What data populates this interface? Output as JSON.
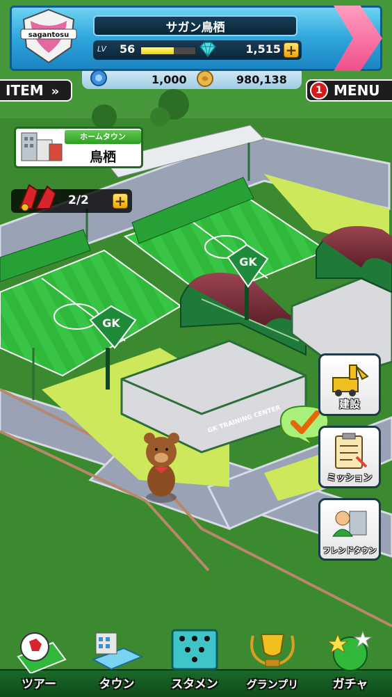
{
  "header": {
    "team_name": "サガン鳥栖",
    "logo_text": "sagantosu",
    "level_label": "LV",
    "level": "56",
    "xp_fraction": 0.6,
    "gems": "1,515",
    "plus": "+",
    "tickets": "1,000",
    "coins": "980,138"
  },
  "left_buttons": {
    "item_label": "ITEM"
  },
  "right_buttons": {
    "menu_label": "MENU",
    "menu_badge": "1"
  },
  "hometown": {
    "title": "ホームタウン",
    "name": "鳥栖"
  },
  "stock": {
    "value": "2/2"
  },
  "scene": {
    "sign_text": "GK",
    "sign_sub": "TRAINING\nCENTER",
    "roof_text": "GK TRAINING CENTER"
  },
  "side_menu": [
    {
      "label": "建設",
      "icon": "construction-icon"
    },
    {
      "label": "ミッション",
      "icon": "mission-clipboard-icon"
    },
    {
      "label": "フレンドタウン",
      "icon": "friend-town-icon"
    }
  ],
  "bottom_nav": [
    {
      "label": "ツアー",
      "icon": "soccer-ball-icon"
    },
    {
      "label": "タウン",
      "icon": "town-icon"
    },
    {
      "label": "スタメン",
      "icon": "lineup-icon"
    },
    {
      "label": "グランプリ",
      "icon": "trophy-icon"
    },
    {
      "label": "ガチャ",
      "icon": "gacha-icon"
    }
  ],
  "colors": {
    "header_blue": "#2fa6dc",
    "grass": "#3c8a2f",
    "pitch": "#2fb83a",
    "road": "#9aa3b5",
    "roof": "#7a2f3a"
  }
}
